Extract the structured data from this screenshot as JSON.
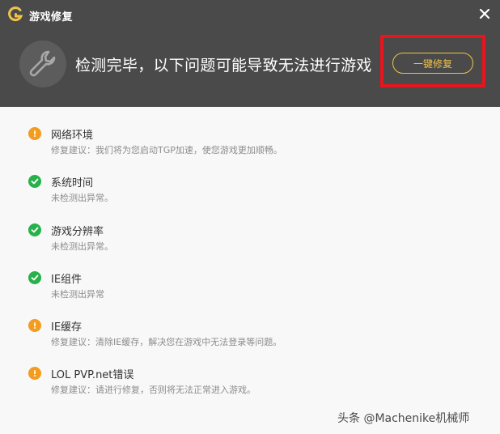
{
  "app": {
    "title": "游戏修复",
    "accent_color": "#f0c24b"
  },
  "header": {
    "headline": "检测完毕，以下问题可能导致无法进行游戏",
    "fix_button_label": "一键修复",
    "icon": "wrench-icon",
    "highlight_color": "#e8141e"
  },
  "items": [
    {
      "status": "warning",
      "title": "网络环境",
      "desc": "修复建议：我们将为您启动TGP加速，使您游戏更加顺畅。"
    },
    {
      "status": "ok",
      "title": "系统时间",
      "desc": "未检测出异常。"
    },
    {
      "status": "ok",
      "title": "游戏分辨率",
      "desc": "未检测出异常。"
    },
    {
      "status": "ok",
      "title": "IE组件",
      "desc": "未检测出异常"
    },
    {
      "status": "warning",
      "title": "IE缓存",
      "desc": "修复建议：清除IE缓存，解决您在游戏中无法登录等问题。"
    },
    {
      "status": "warning",
      "title": "LOL PVP.net错误",
      "desc": "修复建议：请进行修复，否则将无法正常进入游戏。"
    }
  ],
  "watermark": "头条 @Machenike机械师"
}
